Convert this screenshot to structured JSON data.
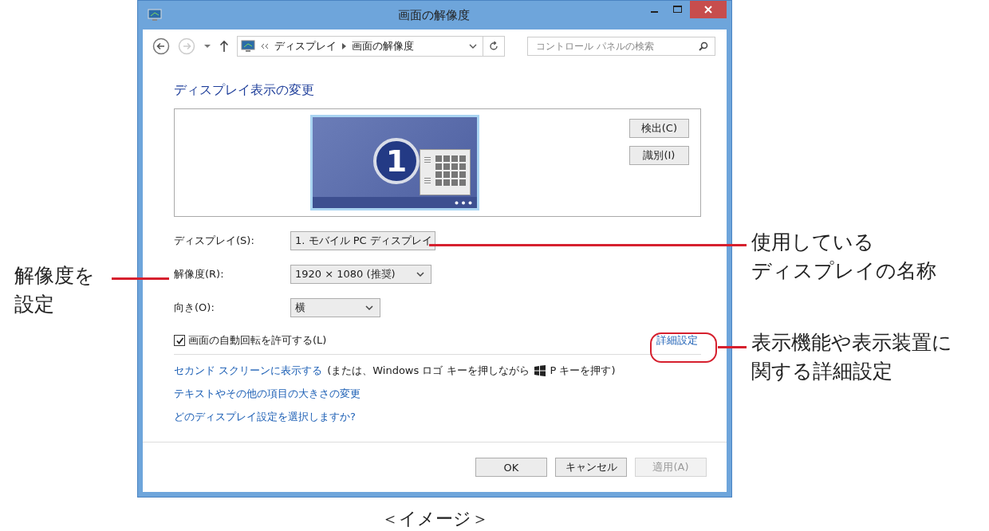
{
  "window": {
    "title": "画面の解像度"
  },
  "nav": {
    "breadcrumb": [
      "ディスプレイ",
      "画面の解像度"
    ],
    "search_placeholder": "コントロール パネルの検索"
  },
  "heading": "ディスプレイ表示の変更",
  "monitor": {
    "number": "1"
  },
  "side_buttons": [
    "検出(C)",
    "識別(I)"
  ],
  "settings": [
    {
      "label": "ディスプレイ(S):",
      "value": "1. モバイル PC ディスプレイ"
    },
    {
      "label": "解像度(R):",
      "value": "1920 × 1080 (推奨)"
    },
    {
      "label": "向き(O):",
      "value": "横"
    }
  ],
  "auto_rotate": {
    "label": "画面の自動回転を許可する(L)",
    "checked": true
  },
  "advanced_link": "詳細設定",
  "second_screen": {
    "link": "セカンド スクリーンに表示する",
    "note": "(または、Windows ロゴ キーを押しながら",
    "note_after": "P キーを押す)"
  },
  "links": [
    "テキストやその他の項目の大きさの変更",
    "どのディスプレイ設定を選択しますか?"
  ],
  "buttons": [
    {
      "label": "OK",
      "disabled": false
    },
    {
      "label": "キャンセル",
      "disabled": false
    },
    {
      "label": "適用(A)",
      "disabled": true
    }
  ],
  "callouts": [
    {
      "lines": [
        "解像度を",
        "設定"
      ]
    },
    {
      "lines": [
        "使用している",
        "ディスプレイの名称"
      ]
    },
    {
      "lines": [
        "表示機能や表示装置に",
        "関する詳細設定"
      ]
    }
  ],
  "caption": "＜イメージ＞"
}
